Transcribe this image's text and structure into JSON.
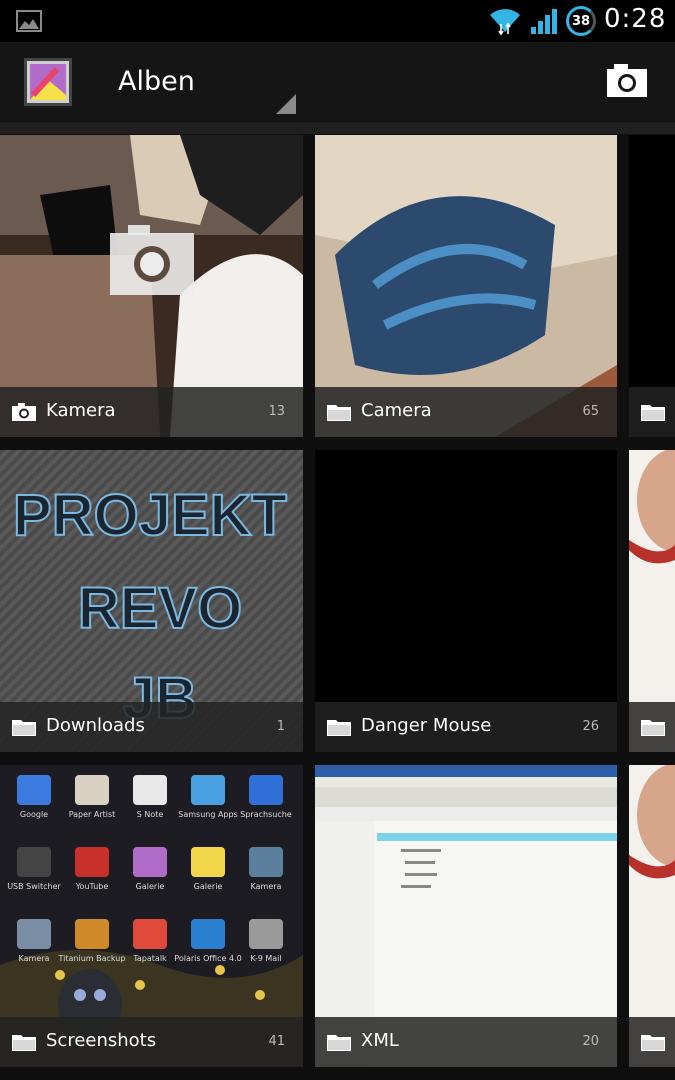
{
  "status_bar": {
    "battery": "38",
    "time": "0:28"
  },
  "action_bar": {
    "title": "Alben"
  },
  "albums": [
    {
      "name": "Kamera",
      "count": "13",
      "icon": "camera-icon"
    },
    {
      "name": "Camera",
      "count": "65",
      "icon": "folder-icon"
    },
    {
      "name": "Downloads",
      "count": "1",
      "icon": "folder-icon"
    },
    {
      "name": "Danger Mouse",
      "count": "26",
      "icon": "folder-icon"
    },
    {
      "name": "Screenshots",
      "count": "41",
      "icon": "folder-icon"
    },
    {
      "name": "XML",
      "count": "20",
      "icon": "folder-icon"
    }
  ],
  "thumbnails": {
    "downloads_text": [
      "PROJEKT",
      "REVO",
      "JB"
    ],
    "screenshot_apps": [
      "Google",
      "Paper Artist",
      "S Note",
      "Samsung Apps",
      "Sprachsuche",
      "USB Switcher",
      "YouTube",
      "Galerie",
      "Galerie",
      "Kamera",
      "Kamera",
      "Titanium Backup",
      "Tapatalk",
      "Polaris Office 4.0",
      "K-9 Mail"
    ]
  }
}
